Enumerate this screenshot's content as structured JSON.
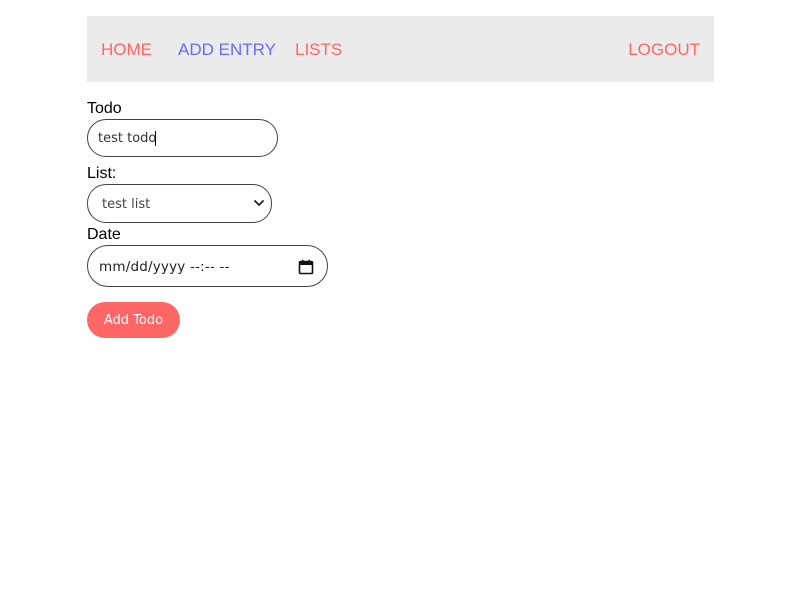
{
  "colors": {
    "accent": "#ff6666",
    "active_link": "#6b6bff",
    "navbar_bg": "#ebebeb"
  },
  "nav": {
    "home": "HOME",
    "add_entry": "ADD ENTRY",
    "lists": "LISTS",
    "logout": "LOGOUT",
    "active": "add_entry"
  },
  "form": {
    "todo_label": "Todo",
    "todo_value": "test todo",
    "list_label": "List:",
    "list_selected": "test list",
    "date_label": "Date",
    "date_placeholder": "mm/dd/yyyy --:-- --",
    "submit_label": "Add Todo"
  },
  "icons": {
    "select": "chevron-down-icon",
    "date": "calendar-icon"
  }
}
